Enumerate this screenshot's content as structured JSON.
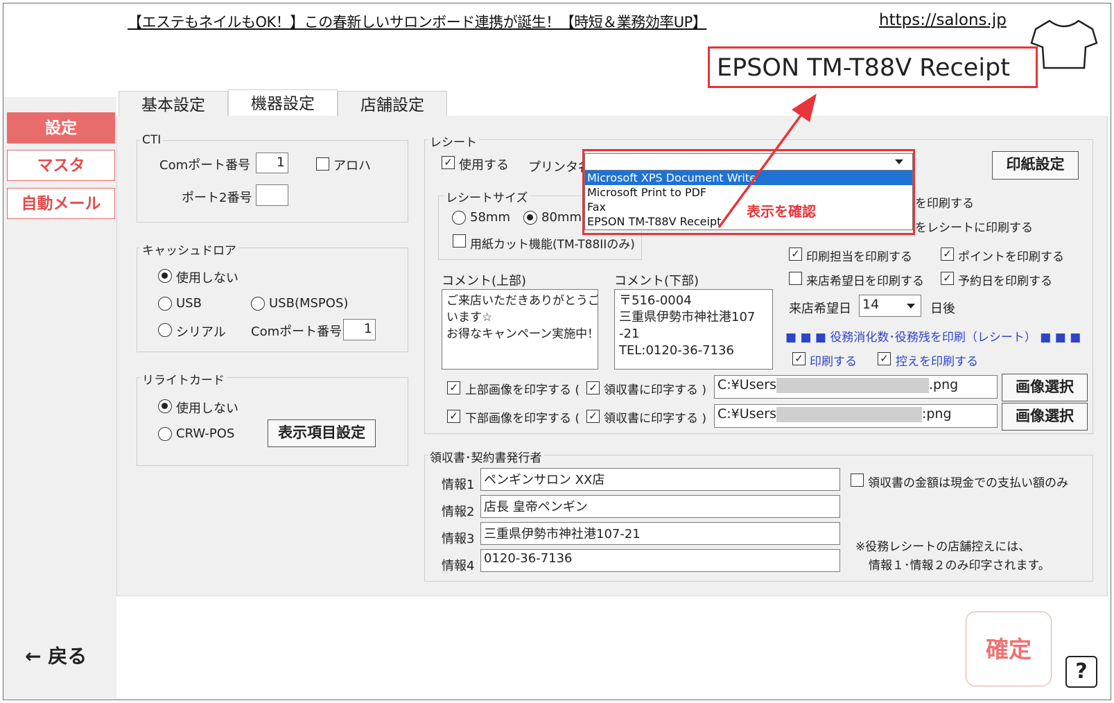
{
  "banner": {
    "text": "【エステもネイルもOK！】この春新しいサロンボード連携が誕生！【時短＆業務効率UP】",
    "url": "https://salons.jp"
  },
  "printer_display": "EPSON TM-T88V Receipt",
  "annotation": {
    "callout": "表示を確認",
    "color": "#e8343a"
  },
  "tabs": [
    {
      "label": "基本設定"
    },
    {
      "label": "機器設定"
    },
    {
      "label": "店舗設定"
    }
  ],
  "sidebar": {
    "items": [
      {
        "label": "設定"
      },
      {
        "label": "マスタ"
      },
      {
        "label": "自動メール"
      }
    ],
    "back_label": "← 戻る"
  },
  "cti": {
    "legend": "CTI",
    "com_port_label": "Comポート番号",
    "com_port_value": "1",
    "aroha_label": "アロハ",
    "port2_label": "ポート2番号",
    "port2_value": ""
  },
  "cash_drawer": {
    "legend": "キャッシュドロア",
    "opt_none": "使用しない",
    "opt_usb": "USB",
    "opt_usb_mspos": "USB(MSPOS)",
    "opt_serial": "シリアル",
    "com_port_label": "Comポート番号",
    "com_port_value": "1"
  },
  "rewrite_card": {
    "legend": "リライトカード",
    "opt_none": "使用しない",
    "opt_crw": "CRW-POS",
    "display_items_button": "表示項目設定"
  },
  "receipt": {
    "legend": "レシート",
    "use_label": "使用する",
    "printer_name_label": "プリンタ名",
    "paper_setting_button": "印紙設定",
    "size_legend": "レシートサイズ",
    "size_58": "58mm",
    "size_80": "80mm",
    "cut_label": "用紙カット機能(TM-T88IIのみ)",
    "printer_options": [
      "Microsoft XPS Document Write",
      "Microsoft Print to PDF",
      "Fax",
      "EPSON TM-T88V Receipt"
    ],
    "hidden_opt1": "を印刷する",
    "hidden_opt2": "をレシートに印刷する",
    "print_staff": "印刷担当を印刷する",
    "print_point": "ポイントを印刷する",
    "print_visit_wish": "来店希望日を印刷する",
    "print_reserve": "予約日を印刷する",
    "visit_wish_label": "来店希望日",
    "visit_wish_value": "14",
    "days_after": "日後",
    "service_heading": "■ ■ ■  役務消化数･役務残を印刷（レシート）  ■ ■ ■",
    "service_print": "印刷する",
    "service_copy": "控えを印刷する",
    "comment_top_label": "コメント(上部)",
    "comment_top_value": "ご来店いただきありがとうござ\nいます☆\nお得なキャンペーン実施中！",
    "comment_bottom_label": "コメント(下部)",
    "comment_bottom_value": "〒516-0004\n三重県伊勢市神社港107\n-21\nTEL:0120-36-7136",
    "top_image_label": "上部画像を印字する (",
    "bottom_image_label": "下部画像を印字する (",
    "on_receipt_label": "領収書に印字する )",
    "top_image_path_a": "C:¥Users",
    "top_image_path_b": ".png",
    "bottom_image_path_a": "C:¥Users",
    "bottom_image_path_b": ":png",
    "image_select_button": "画像選択"
  },
  "issuer": {
    "legend": "領収書･契約書発行者",
    "info1_label": "情報1",
    "info1_value": "ペンギンサロン  XX店",
    "info2_label": "情報2",
    "info2_value": "店長  皇帝ペンギン",
    "info3_label": "情報3",
    "info3_value": "三重県伊勢市神社港107-21",
    "info4_label": "情報4",
    "info4_value": "0120-36-7136",
    "cash_only_label": "領収書の金額は現金での支払い額のみ",
    "note_line1": "※役務レシートの店舗控えには、",
    "note_line2": "情報１･情報２のみ印字されます。"
  },
  "confirm_button": "確定",
  "help_button": "?"
}
